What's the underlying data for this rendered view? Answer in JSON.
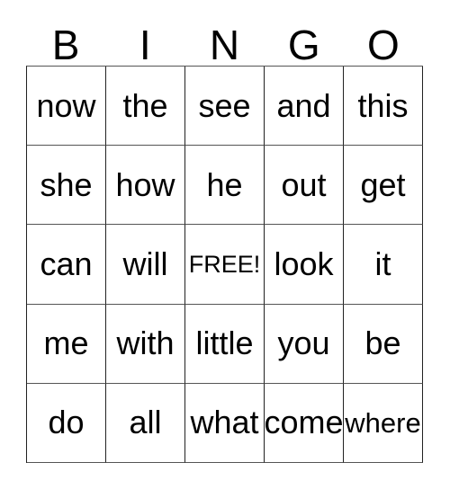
{
  "card": {
    "title": "BINGO",
    "header_letters": [
      "B",
      "I",
      "N",
      "G",
      "O"
    ],
    "colors": {
      "background": "#ffffff",
      "text": "#000000",
      "grid_line": "#222222"
    },
    "grid": {
      "columns": 5,
      "rows": 5,
      "free_space": {
        "row": 3,
        "column": 3,
        "label": "FREE!"
      },
      "cells": [
        [
          {
            "word": "now",
            "size": "normal"
          },
          {
            "word": "the",
            "size": "normal"
          },
          {
            "word": "see",
            "size": "normal"
          },
          {
            "word": "and",
            "size": "normal"
          },
          {
            "word": "this",
            "size": "normal"
          }
        ],
        [
          {
            "word": "she",
            "size": "normal"
          },
          {
            "word": "how",
            "size": "normal"
          },
          {
            "word": "he",
            "size": "normal"
          },
          {
            "word": "out",
            "size": "normal"
          },
          {
            "word": "get",
            "size": "normal"
          }
        ],
        [
          {
            "word": "can",
            "size": "normal"
          },
          {
            "word": "will",
            "size": "normal"
          },
          {
            "word": "FREE!",
            "size": "small"
          },
          {
            "word": "look",
            "size": "normal"
          },
          {
            "word": "it",
            "size": "normal"
          }
        ],
        [
          {
            "word": "me",
            "size": "normal"
          },
          {
            "word": "with",
            "size": "normal"
          },
          {
            "word": "little",
            "size": "normal"
          },
          {
            "word": "you",
            "size": "normal"
          },
          {
            "word": "be",
            "size": "normal"
          }
        ],
        [
          {
            "word": "do",
            "size": "normal"
          },
          {
            "word": "all",
            "size": "normal"
          },
          {
            "word": "what",
            "size": "normal"
          },
          {
            "word": "come",
            "size": "normal"
          },
          {
            "word": "where",
            "size": "medium"
          }
        ]
      ]
    }
  }
}
